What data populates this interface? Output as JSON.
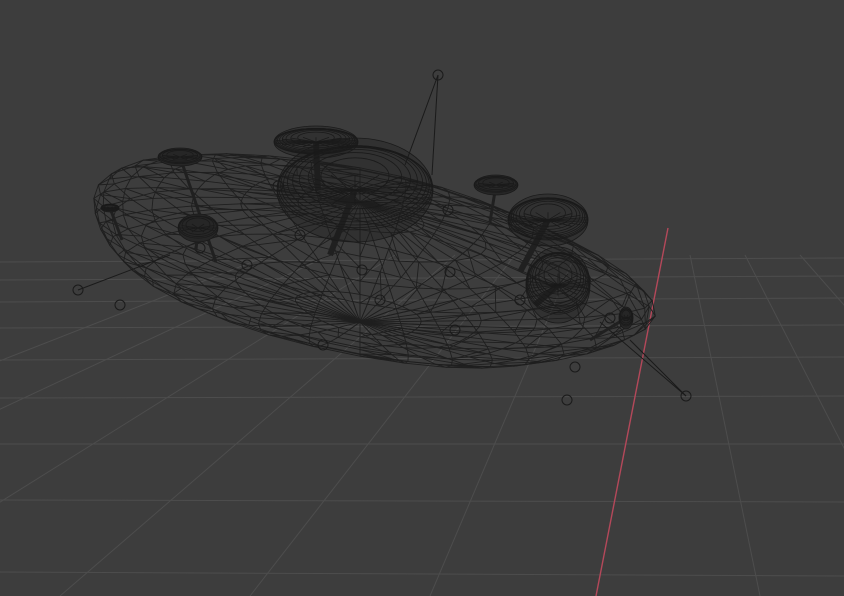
{
  "viewport": {
    "mode": "wireframe",
    "background_color": "#3d3d3d",
    "grid_color": "#4d4d4d",
    "x_axis_color": "#b4485a",
    "wire_color": "#1f1f1f",
    "empties_color": "#1a1a1a"
  },
  "scene": {
    "objects": [
      {
        "name": "rock-mesh",
        "type": "mesh"
      },
      {
        "name": "mushroom-cluster",
        "type": "mesh",
        "count": 9
      },
      {
        "name": "empty-markers",
        "type": "empty",
        "count": 18
      }
    ]
  }
}
